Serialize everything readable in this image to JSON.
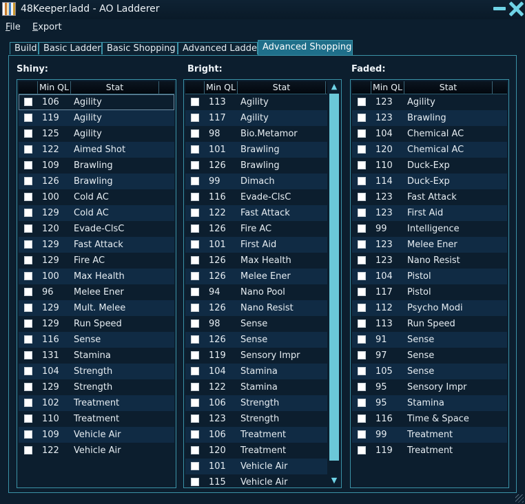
{
  "window": {
    "title": "48Keeper.ladd - AO Ladderer"
  },
  "menu": [
    {
      "underline": "F",
      "rest": "ile"
    },
    {
      "underline": "E",
      "rest": "xport"
    }
  ],
  "tabs": [
    "Build",
    "Basic Ladder",
    "Basic Shopping",
    "Advanced Ladder",
    "Advanced Shopping"
  ],
  "active_tab": "Advanced Shopping",
  "columns": {
    "ql": "Min QL",
    "stat": "Stat"
  },
  "lists": [
    {
      "title": "Shiny:",
      "rows": [
        {
          "ql": "106",
          "stat": "Agility"
        },
        {
          "ql": "119",
          "stat": "Agility"
        },
        {
          "ql": "125",
          "stat": "Agility"
        },
        {
          "ql": "122",
          "stat": "Aimed Shot"
        },
        {
          "ql": "109",
          "stat": "Brawling"
        },
        {
          "ql": "126",
          "stat": "Brawling"
        },
        {
          "ql": "100",
          "stat": "Cold AC"
        },
        {
          "ql": "129",
          "stat": "Cold AC"
        },
        {
          "ql": "120",
          "stat": "Evade-ClsC"
        },
        {
          "ql": "129",
          "stat": "Fast Attack"
        },
        {
          "ql": "129",
          "stat": "Fire AC"
        },
        {
          "ql": "100",
          "stat": "Max Health"
        },
        {
          "ql": "96",
          "stat": "Melee Ener"
        },
        {
          "ql": "129",
          "stat": "Mult. Melee"
        },
        {
          "ql": "129",
          "stat": "Run Speed"
        },
        {
          "ql": "116",
          "stat": "Sense"
        },
        {
          "ql": "131",
          "stat": "Stamina"
        },
        {
          "ql": "104",
          "stat": "Strength"
        },
        {
          "ql": "129",
          "stat": "Strength"
        },
        {
          "ql": "102",
          "stat": "Treatment"
        },
        {
          "ql": "110",
          "stat": "Treatment"
        },
        {
          "ql": "109",
          "stat": "Vehicle Air"
        },
        {
          "ql": "122",
          "stat": "Vehicle Air"
        }
      ]
    },
    {
      "title": "Bright:",
      "rows": [
        {
          "ql": "113",
          "stat": "Agility"
        },
        {
          "ql": "117",
          "stat": "Agility"
        },
        {
          "ql": "98",
          "stat": "Bio.Metamor"
        },
        {
          "ql": "101",
          "stat": "Brawling"
        },
        {
          "ql": "126",
          "stat": "Brawling"
        },
        {
          "ql": "99",
          "stat": "Dimach"
        },
        {
          "ql": "116",
          "stat": "Evade-ClsC"
        },
        {
          "ql": "122",
          "stat": "Fast Attack"
        },
        {
          "ql": "126",
          "stat": "Fire AC"
        },
        {
          "ql": "101",
          "stat": "First Aid"
        },
        {
          "ql": "126",
          "stat": "Max Health"
        },
        {
          "ql": "126",
          "stat": "Melee Ener"
        },
        {
          "ql": "94",
          "stat": "Nano Pool"
        },
        {
          "ql": "126",
          "stat": "Nano Resist"
        },
        {
          "ql": "98",
          "stat": "Sense"
        },
        {
          "ql": "126",
          "stat": "Sense"
        },
        {
          "ql": "119",
          "stat": "Sensory Impr"
        },
        {
          "ql": "104",
          "stat": "Stamina"
        },
        {
          "ql": "122",
          "stat": "Stamina"
        },
        {
          "ql": "106",
          "stat": "Strength"
        },
        {
          "ql": "123",
          "stat": "Strength"
        },
        {
          "ql": "106",
          "stat": "Treatment"
        },
        {
          "ql": "120",
          "stat": "Treatment"
        },
        {
          "ql": "101",
          "stat": "Vehicle Air"
        },
        {
          "ql": "115",
          "stat": "Vehicle Air"
        }
      ]
    },
    {
      "title": "Faded:",
      "rows": [
        {
          "ql": "123",
          "stat": "Agility"
        },
        {
          "ql": "123",
          "stat": "Brawling"
        },
        {
          "ql": "104",
          "stat": "Chemical AC"
        },
        {
          "ql": "120",
          "stat": "Chemical AC"
        },
        {
          "ql": "110",
          "stat": "Duck-Exp"
        },
        {
          "ql": "114",
          "stat": "Duck-Exp"
        },
        {
          "ql": "123",
          "stat": "Fast Attack"
        },
        {
          "ql": "123",
          "stat": "First Aid"
        },
        {
          "ql": "99",
          "stat": "Intelligence"
        },
        {
          "ql": "123",
          "stat": "Melee Ener"
        },
        {
          "ql": "123",
          "stat": "Nano Resist"
        },
        {
          "ql": "104",
          "stat": "Pistol"
        },
        {
          "ql": "117",
          "stat": "Pistol"
        },
        {
          "ql": "112",
          "stat": "Psycho Modi"
        },
        {
          "ql": "113",
          "stat": "Run Speed"
        },
        {
          "ql": "91",
          "stat": "Sense"
        },
        {
          "ql": "97",
          "stat": "Sense"
        },
        {
          "ql": "105",
          "stat": "Sense"
        },
        {
          "ql": "95",
          "stat": "Sensory Impr"
        },
        {
          "ql": "95",
          "stat": "Stamina"
        },
        {
          "ql": "116",
          "stat": "Time & Space"
        },
        {
          "ql": "99",
          "stat": "Treatment"
        },
        {
          "ql": "119",
          "stat": "Treatment"
        }
      ]
    }
  ]
}
